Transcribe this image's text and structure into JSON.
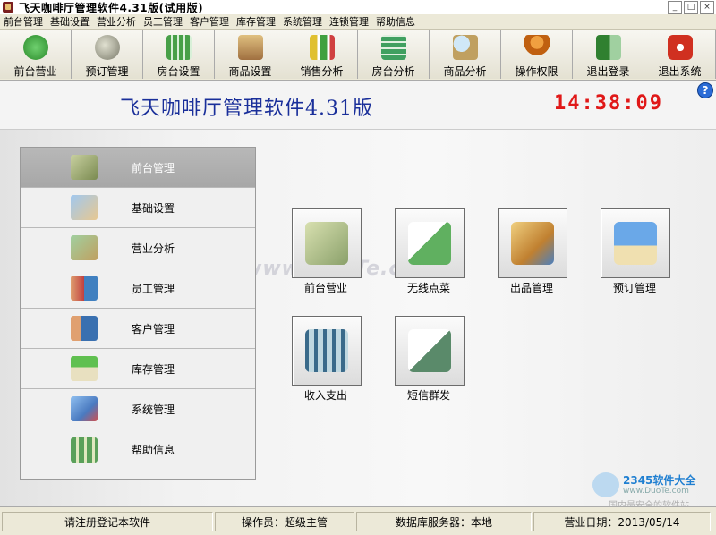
{
  "window": {
    "title": "飞天咖啡厅管理软件4.31版(试用版)"
  },
  "menu": [
    "前台管理",
    "基础设置",
    "营业分析",
    "员工管理",
    "客户管理",
    "库存管理",
    "系统管理",
    "连锁管理",
    "帮助信息"
  ],
  "toolbar": [
    {
      "label": "前台营业",
      "icon": "cash-register-icon",
      "color": "#3aa23a"
    },
    {
      "label": "预订管理",
      "icon": "globe-icon",
      "color": "#8a7a5a"
    },
    {
      "label": "房台设置",
      "icon": "grid-table-icon",
      "color": "#48a048"
    },
    {
      "label": "商品设置",
      "icon": "box-stack-icon",
      "color": "#b08040"
    },
    {
      "label": "销售分析",
      "icon": "bar-chart-icon",
      "color": "#e0c030"
    },
    {
      "label": "房台分析",
      "icon": "grid-analysis-icon",
      "color": "#40a060"
    },
    {
      "label": "商品分析",
      "icon": "magnifier-box-icon",
      "color": "#c0a060"
    },
    {
      "label": "操作权限",
      "icon": "user-lock-icon",
      "color": "#e08020"
    },
    {
      "label": "退出登录",
      "icon": "exit-door-icon",
      "color": "#308030"
    },
    {
      "label": "退出系统",
      "icon": "power-icon",
      "color": "#d03020"
    }
  ],
  "header": {
    "app_title": "飞天咖啡厅管理软件4.31版",
    "clock": "14:38:09"
  },
  "sidebar": [
    {
      "label": "前台管理",
      "icon": "register-icon",
      "color": "#9aa56a"
    },
    {
      "label": "基础设置",
      "icon": "settings-book-icon",
      "color": "#5a8ac0"
    },
    {
      "label": "营业分析",
      "icon": "analysis-chart-icon",
      "color": "#7aa07a"
    },
    {
      "label": "员工管理",
      "icon": "staff-icon",
      "color": "#c05050"
    },
    {
      "label": "客户管理",
      "icon": "customer-icon",
      "color": "#3a70b0"
    },
    {
      "label": "库存管理",
      "icon": "warehouse-icon",
      "color": "#4aa040"
    },
    {
      "label": "系统管理",
      "icon": "system-monitor-icon",
      "color": "#4a7ac0"
    },
    {
      "label": "帮助信息",
      "icon": "help-books-icon",
      "color": "#5aa05a"
    }
  ],
  "tiles": [
    {
      "label": "前台营业",
      "icon": "register-tile-icon",
      "color": "#8aa06a"
    },
    {
      "label": "无线点菜",
      "icon": "wireless-order-icon",
      "color": "#60b060"
    },
    {
      "label": "出品管理",
      "icon": "delivery-icon",
      "color": "#d0a040"
    },
    {
      "label": "预订管理",
      "icon": "reservation-book-icon",
      "color": "#4a8ac8"
    },
    {
      "label": "收入支出",
      "icon": "abacus-icon",
      "color": "#5a8a9a"
    },
    {
      "label": "短信群发",
      "icon": "sms-mail-icon",
      "color": "#5a8a6a"
    }
  ],
  "watermark": {
    "text": "www.DuoTe.com",
    "brand": "2345软件大全",
    "url": "www.DuoTe.com",
    "tag": "国内最安全的软件站"
  },
  "statusbar": {
    "register": "请注册登记本软件",
    "operator": "操作员：超级主管",
    "db_server": "数据库服务器：本地",
    "business_date": "营业日期：2013/05/14"
  }
}
